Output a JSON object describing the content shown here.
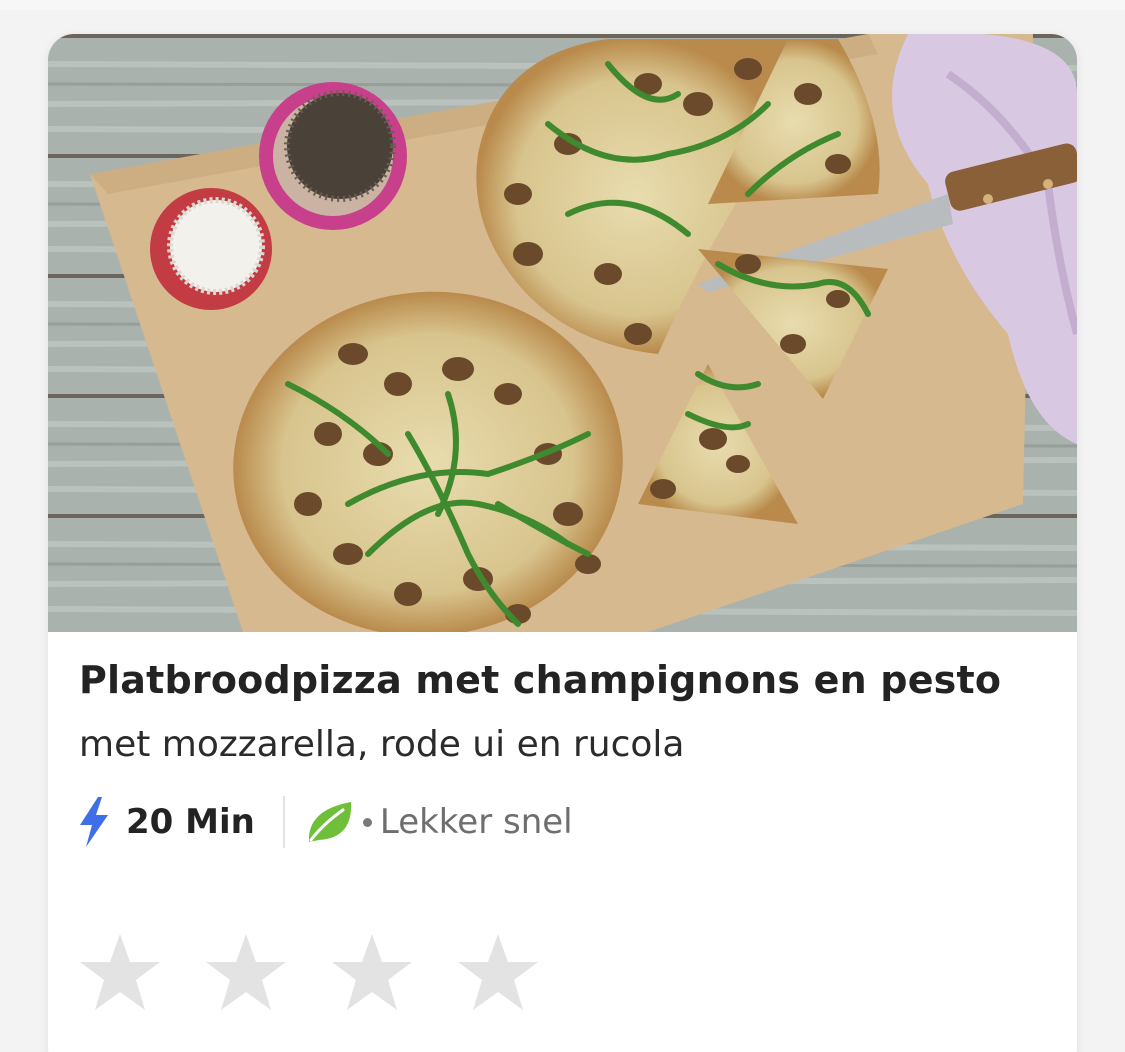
{
  "recipe": {
    "title": "Platbroodpizza met champignons en pesto",
    "subtitle": "met mozzarella, rode ui en rucola",
    "time": "20 Min",
    "tag": "Lekker snel",
    "image_alt": "Platbroodpizza met champignons, rucola en pesto op een houten plank",
    "rating": {
      "filled": 0,
      "total": 4
    }
  },
  "icons": {
    "time": "bolt-icon",
    "tag": "leaf-icon",
    "rating": "star-icon"
  },
  "colors": {
    "bolt": "#3e6fe8",
    "leaf": "#6fbf3a",
    "star_empty": "#e3e3e3",
    "title": "#232323",
    "tag": "#6e6e6e"
  }
}
